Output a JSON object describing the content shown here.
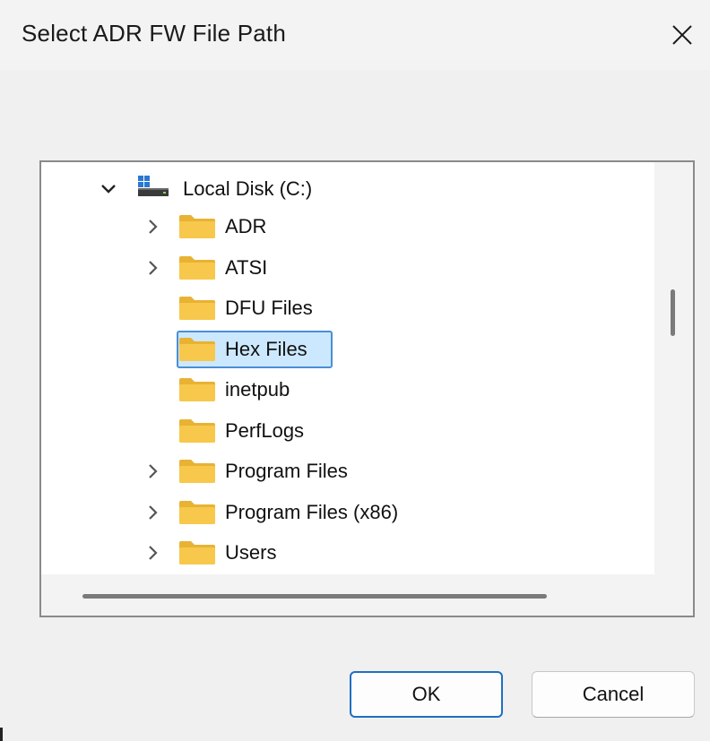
{
  "window": {
    "title": "Select ADR FW File Path",
    "close_icon": "close-icon"
  },
  "tree": {
    "root": {
      "label": "Local Disk (C:)",
      "icon": "drive-icon",
      "expanded": true
    },
    "items": [
      {
        "label": "ADR",
        "has_children": true,
        "selected": false
      },
      {
        "label": "ATSI",
        "has_children": true,
        "selected": false
      },
      {
        "label": "DFU Files",
        "has_children": false,
        "selected": false
      },
      {
        "label": "Hex Files",
        "has_children": false,
        "selected": true
      },
      {
        "label": "inetpub",
        "has_children": false,
        "selected": false
      },
      {
        "label": "PerfLogs",
        "has_children": false,
        "selected": false
      },
      {
        "label": "Program Files",
        "has_children": true,
        "selected": false
      },
      {
        "label": "Program Files (x86)",
        "has_children": true,
        "selected": false
      },
      {
        "label": "Users",
        "has_children": true,
        "selected": false
      }
    ]
  },
  "buttons": {
    "ok_label": "OK",
    "cancel_label": "Cancel"
  },
  "colors": {
    "folder": "#f7c84b",
    "folder_tab": "#e8b233",
    "selection_bg": "#cce8ff",
    "selection_border": "#4a8fd6",
    "ok_border": "#1f6fc2"
  }
}
